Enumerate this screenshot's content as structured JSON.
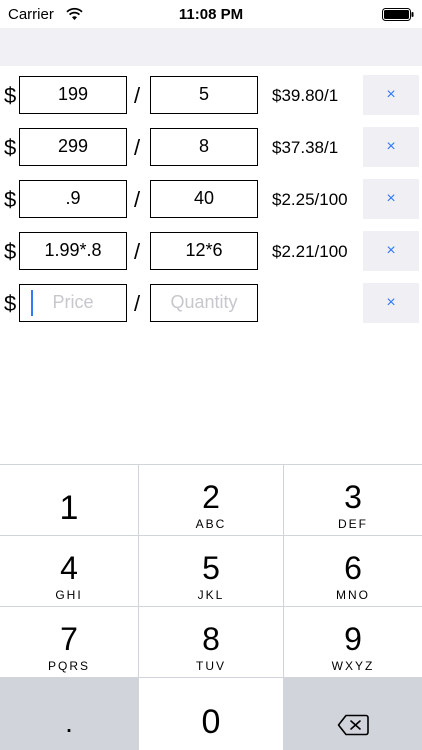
{
  "status_bar": {
    "carrier": "Carrier",
    "time": "11:08 PM",
    "wifi_icon": "wifi-icon",
    "battery_icon": "battery-icon"
  },
  "rows": [
    {
      "price": "199",
      "quantity": "5",
      "unit_price": "$39.80/1",
      "currency": "$",
      "divider": "/",
      "remove": "×"
    },
    {
      "price": "299",
      "quantity": "8",
      "unit_price": "$37.38/1",
      "currency": "$",
      "divider": "/",
      "remove": "×"
    },
    {
      "price": ".9",
      "quantity": "40",
      "unit_price": "$2.25/100",
      "currency": "$",
      "divider": "/",
      "remove": "×"
    },
    {
      "price": "1.99*.8",
      "quantity": "12*6",
      "unit_price": "$2.21/100",
      "currency": "$",
      "divider": "/",
      "remove": "×"
    }
  ],
  "new_row": {
    "currency": "$",
    "divider": "/",
    "price_placeholder": "Price",
    "quantity_placeholder": "Quantity",
    "remove": "×"
  },
  "keypad": {
    "keys": [
      {
        "digit": "1",
        "letters": ""
      },
      {
        "digit": "2",
        "letters": "ABC"
      },
      {
        "digit": "3",
        "letters": "DEF"
      },
      {
        "digit": "4",
        "letters": "GHI"
      },
      {
        "digit": "5",
        "letters": "JKL"
      },
      {
        "digit": "6",
        "letters": "MNO"
      },
      {
        "digit": "7",
        "letters": "PQRS"
      },
      {
        "digit": "8",
        "letters": "TUV"
      },
      {
        "digit": "9",
        "letters": "WXYZ"
      }
    ],
    "decimal": ".",
    "zero": "0",
    "backspace_icon": "backspace-icon"
  },
  "colors": {
    "accent": "#3478f6",
    "nav_background": "#f0f0f5",
    "button_background": "#efeff4",
    "keypad_dark": "#d1d5db",
    "placeholder": "#c7c7cd"
  }
}
